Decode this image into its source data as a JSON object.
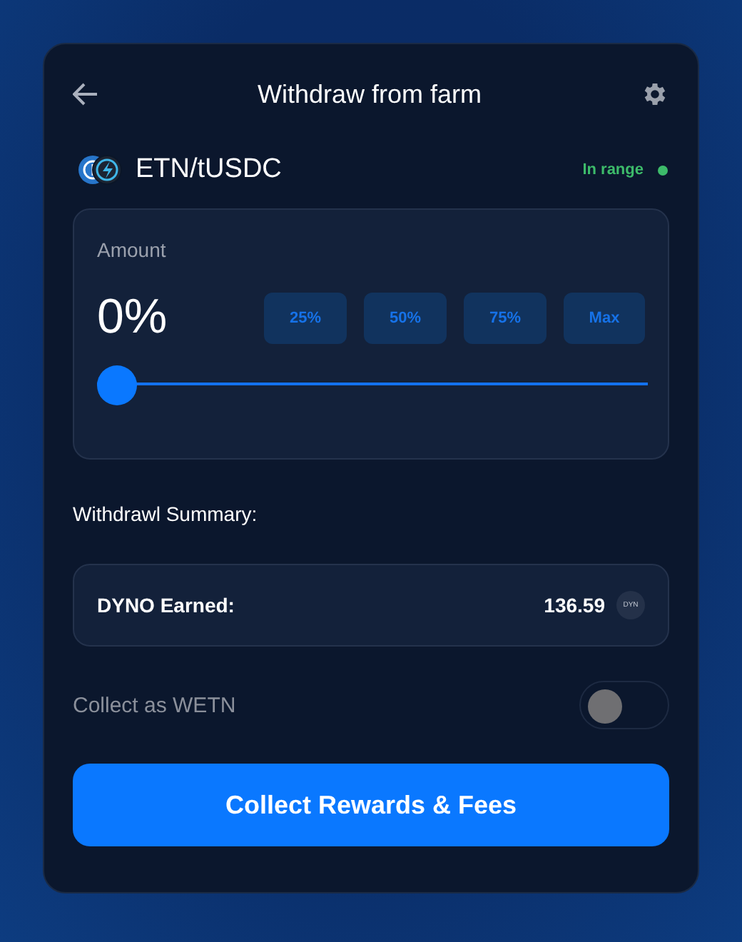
{
  "header": {
    "title": "Withdraw from farm"
  },
  "pool": {
    "pair": "ETN/tUSDC",
    "status": "In range"
  },
  "amount": {
    "label": "Amount",
    "value": "0%",
    "level": 0,
    "presets": [
      "25%",
      "50%",
      "75%",
      "Max"
    ]
  },
  "summary": {
    "title": "Withdrawl Summary:",
    "label": "DYNO Earned:",
    "value": "136.59",
    "token": "DYN"
  },
  "collect_toggle": {
    "label": "Collect as WETN",
    "on": false
  },
  "submit": "Collect Rewards & Fees"
}
